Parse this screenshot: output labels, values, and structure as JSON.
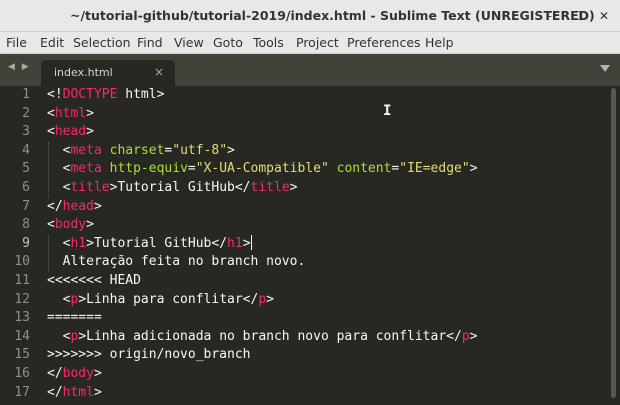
{
  "window": {
    "title": "~/tutorial-github/tutorial-2019/index.html - Sublime Text (UNREGISTERED)",
    "minimize": "–",
    "maximize": "☐",
    "close": "✕"
  },
  "menu": [
    "File",
    "Edit",
    "Selection",
    "Find",
    "View",
    "Goto",
    "Tools",
    "Project",
    "Preferences",
    "Help"
  ],
  "tabs": {
    "nav": "◀ ▶",
    "active": {
      "label": "index.html",
      "close": "×"
    }
  },
  "editor": {
    "line_numbers": [
      "1",
      "2",
      "3",
      "4",
      "5",
      "6",
      "7",
      "8",
      "9",
      "10",
      "11",
      "12",
      "13",
      "14",
      "15",
      "16",
      "17"
    ],
    "current_line": 9,
    "lines": [
      [
        {
          "t": "<!",
          "c": ""
        },
        {
          "t": "DOCTYPE",
          "c": "tg"
        },
        {
          "t": " html>",
          "c": ""
        }
      ],
      [
        {
          "t": "<",
          "c": ""
        },
        {
          "t": "html",
          "c": "tg"
        },
        {
          "t": ">",
          "c": ""
        }
      ],
      [
        {
          "t": "<",
          "c": ""
        },
        {
          "t": "head",
          "c": "tg"
        },
        {
          "t": ">",
          "c": ""
        }
      ],
      [
        {
          "t": "  <",
          "c": ""
        },
        {
          "t": "meta",
          "c": "tg"
        },
        {
          "t": " ",
          "c": ""
        },
        {
          "t": "charset",
          "c": "at"
        },
        {
          "t": "=",
          "c": ""
        },
        {
          "t": "\"utf-8\"",
          "c": "st"
        },
        {
          "t": ">",
          "c": ""
        }
      ],
      [
        {
          "t": "  <",
          "c": ""
        },
        {
          "t": "meta",
          "c": "tg"
        },
        {
          "t": " ",
          "c": ""
        },
        {
          "t": "http-equiv",
          "c": "at"
        },
        {
          "t": "=",
          "c": ""
        },
        {
          "t": "\"X-UA-Compatible\"",
          "c": "st"
        },
        {
          "t": " ",
          "c": ""
        },
        {
          "t": "content",
          "c": "at"
        },
        {
          "t": "=",
          "c": ""
        },
        {
          "t": "\"IE=edge\"",
          "c": "st"
        },
        {
          "t": ">",
          "c": ""
        }
      ],
      [
        {
          "t": "  <",
          "c": ""
        },
        {
          "t": "title",
          "c": "tg"
        },
        {
          "t": ">Tutorial GitHub</",
          "c": ""
        },
        {
          "t": "title",
          "c": "tg"
        },
        {
          "t": ">",
          "c": ""
        }
      ],
      [
        {
          "t": "</",
          "c": ""
        },
        {
          "t": "head",
          "c": "tg"
        },
        {
          "t": ">",
          "c": ""
        }
      ],
      [
        {
          "t": "<",
          "c": ""
        },
        {
          "t": "body",
          "c": "tg"
        },
        {
          "t": ">",
          "c": ""
        }
      ],
      [
        {
          "t": "  <",
          "c": ""
        },
        {
          "t": "h1",
          "c": "tg"
        },
        {
          "t": ">Tutorial GitHub</",
          "c": ""
        },
        {
          "t": "h1",
          "c": "tg"
        },
        {
          "t": ">",
          "c": ""
        }
      ],
      [
        {
          "t": "  Alteração feita no branch novo.",
          "c": ""
        }
      ],
      [
        {
          "t": "<<<<<<< HEAD",
          "c": ""
        }
      ],
      [
        {
          "t": "  <",
          "c": ""
        },
        {
          "t": "p",
          "c": "tg"
        },
        {
          "t": ">Linha para conflitar</",
          "c": ""
        },
        {
          "t": "p",
          "c": "tg"
        },
        {
          "t": ">",
          "c": ""
        }
      ],
      [
        {
          "t": "=======",
          "c": ""
        }
      ],
      [
        {
          "t": "  <",
          "c": ""
        },
        {
          "t": "p",
          "c": "tg"
        },
        {
          "t": ">Linha adicionada no branch novo para conflitar</",
          "c": ""
        },
        {
          "t": "p",
          "c": "tg"
        },
        {
          "t": ">",
          "c": ""
        }
      ],
      [
        {
          "t": ">>>>>>> origin/novo_branch",
          "c": ""
        }
      ],
      [
        {
          "t": "</",
          "c": ""
        },
        {
          "t": "body",
          "c": "tg"
        },
        {
          "t": ">",
          "c": ""
        }
      ],
      [
        {
          "t": "</",
          "c": ""
        },
        {
          "t": "html",
          "c": "tg"
        },
        {
          "t": ">",
          "c": ""
        }
      ]
    ]
  },
  "colors": {
    "background": "#272822",
    "tag": "#f92672",
    "attribute": "#a6e22e",
    "string": "#e6db74",
    "text": "#f8f8f2",
    "line_number": "#8f908a"
  }
}
